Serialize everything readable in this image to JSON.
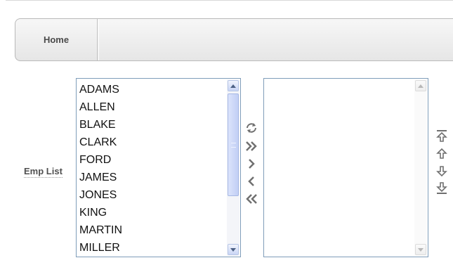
{
  "tabs": [
    {
      "label": "Home"
    }
  ],
  "form": {
    "label": "Emp List"
  },
  "available_list": {
    "items": [
      "ADAMS",
      "ALLEN",
      "BLAKE",
      "CLARK",
      "FORD",
      "JAMES",
      "JONES",
      "KING",
      "MARTIN",
      "MILLER"
    ]
  },
  "selected_list": {
    "items": []
  },
  "shuttle_controls": [
    {
      "name": "reset",
      "icon": "reset-icon"
    },
    {
      "name": "move-all",
      "icon": "double-right-icon"
    },
    {
      "name": "move",
      "icon": "right-icon"
    },
    {
      "name": "remove",
      "icon": "left-icon"
    },
    {
      "name": "remove-all",
      "icon": "double-left-icon"
    }
  ],
  "order_controls": [
    {
      "name": "top",
      "icon": "move-top-icon"
    },
    {
      "name": "up",
      "icon": "move-up-icon"
    },
    {
      "name": "down",
      "icon": "move-down-icon"
    },
    {
      "name": "bottom",
      "icon": "move-bottom-icon"
    }
  ],
  "colors": {
    "border": "#7f9db9",
    "scroll_thumb": "#c2cff5",
    "icon_gray": "#707070"
  }
}
